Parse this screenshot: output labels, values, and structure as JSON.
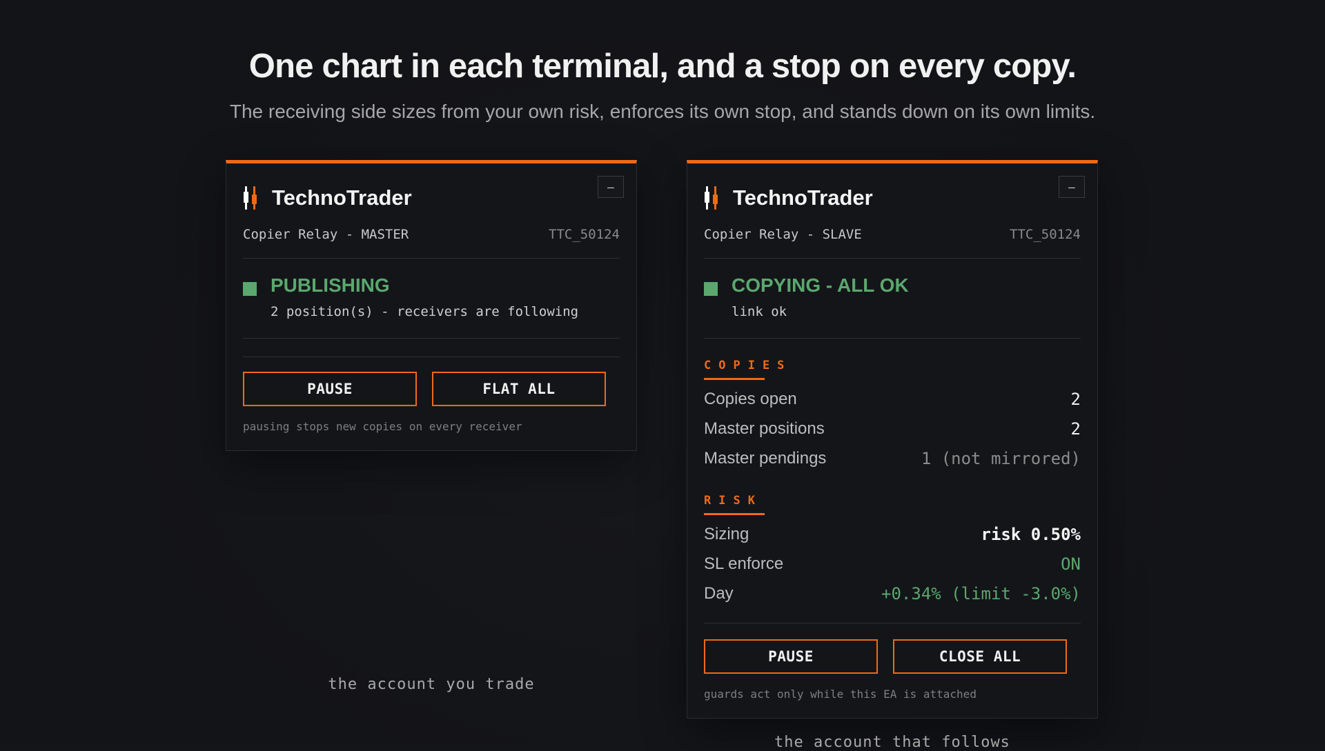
{
  "hero": {
    "title": "One chart in each terminal, and a stop on every copy.",
    "subtitle": "The receiving side sizes from your own risk, enforces its own stop, and stands down on its own limits."
  },
  "master": {
    "minimize_label": "–",
    "brand": "TechnoTrader",
    "relay": "Copier Relay - MASTER",
    "account": "TTC_50124",
    "status_title": "PUBLISHING",
    "status_sub": "2 position(s) - receivers are following",
    "pause_label": "PAUSE",
    "flat_label": "FLAT ALL",
    "note": "pausing stops new copies on every receiver",
    "caption": "the account you trade"
  },
  "slave": {
    "minimize_label": "–",
    "brand": "TechnoTrader",
    "relay": "Copier Relay - SLAVE",
    "account": "TTC_50124",
    "status_title": "COPYING - ALL OK",
    "status_sub": "link ok",
    "copies_section": "COPIES",
    "copies_rows": [
      {
        "label": "Copies open",
        "value": "2"
      },
      {
        "label": "Master positions",
        "value": "2"
      },
      {
        "label": "Master pendings",
        "value": "1 (not mirrored)"
      }
    ],
    "risk_section": "RISK",
    "risk_rows": [
      {
        "label": "Sizing",
        "value": "risk 0.50%"
      },
      {
        "label": "SL enforce",
        "value": "ON"
      },
      {
        "label": "Day",
        "value": "+0.34% (limit -3.0%)"
      }
    ],
    "pause_label": "PAUSE",
    "close_label": "CLOSE ALL",
    "note": "guards act only while this EA is attached",
    "caption": "the account that follows"
  },
  "colors": {
    "accent": "#f06a17",
    "ok": "#5aa86e",
    "background": "#141519"
  }
}
